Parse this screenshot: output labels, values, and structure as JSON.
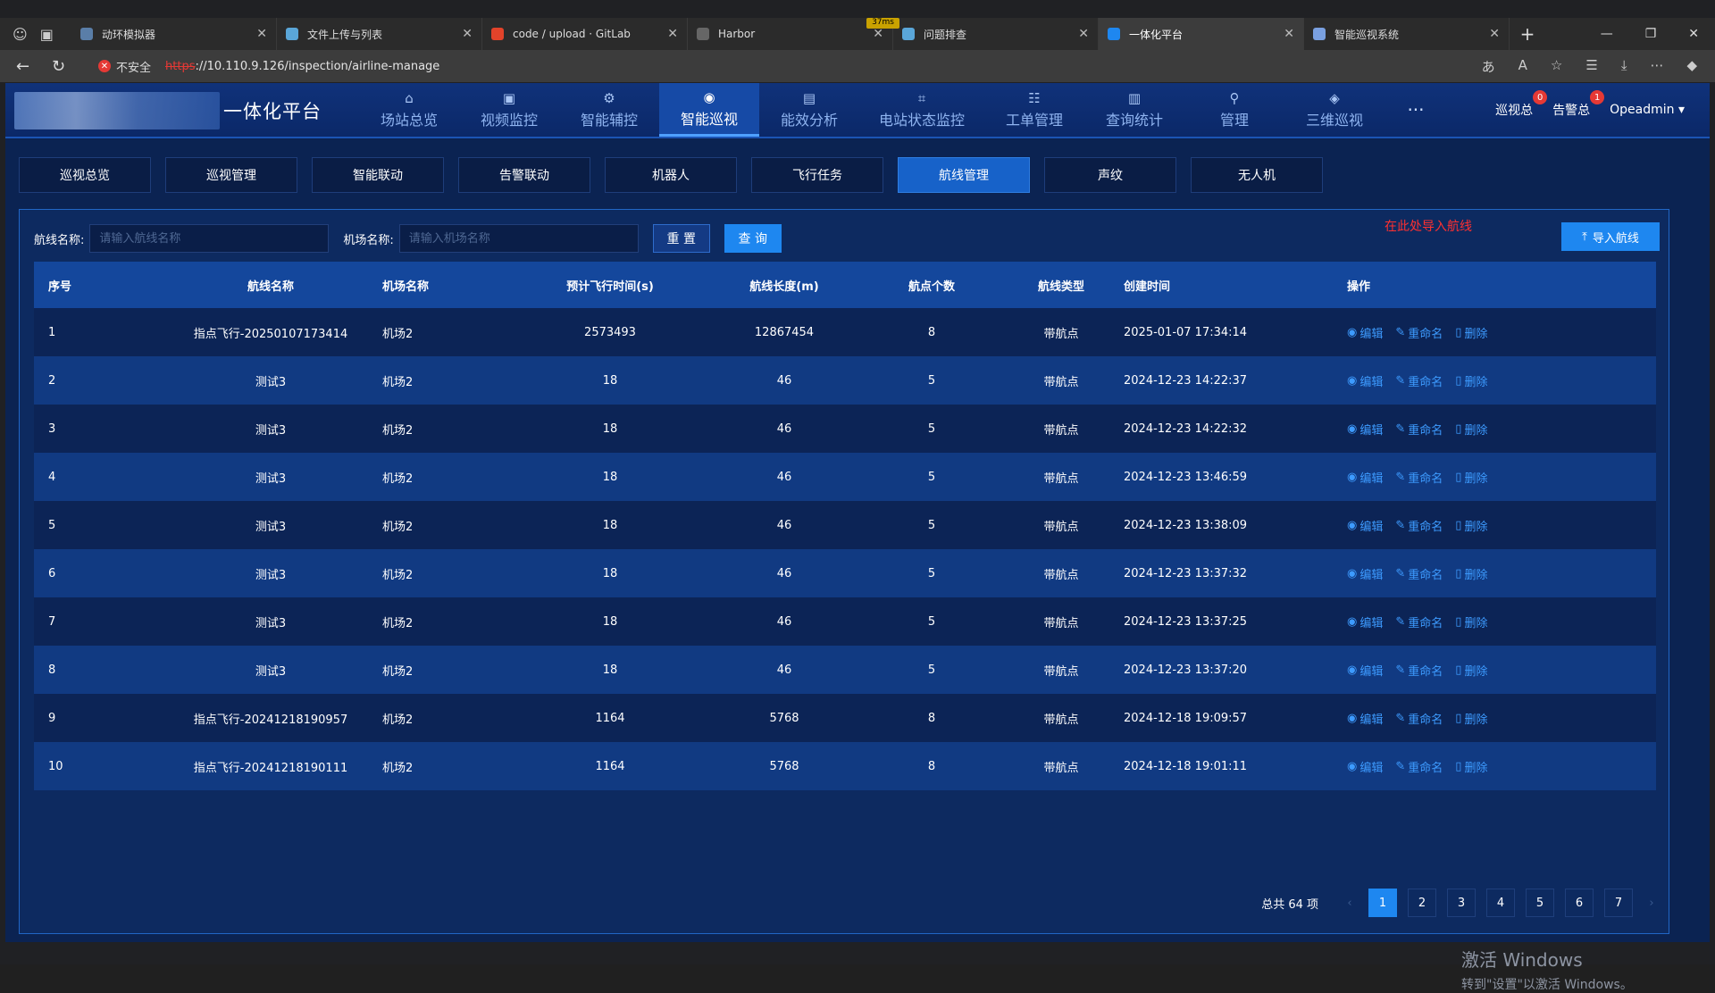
{
  "browser": {
    "tabs": [
      {
        "title": "动环模拟器",
        "color": "#5a7ea8"
      },
      {
        "title": "文件上传与列表",
        "color": "#5aa6d8"
      },
      {
        "title": "code / upload · GitLab",
        "color": "#e2432a"
      },
      {
        "title": "Harbor",
        "color": "#666666"
      },
      {
        "title": "问题排查",
        "color": "#5aa6d8"
      },
      {
        "title": "一体化平台",
        "color": "#1e87f0"
      },
      {
        "title": "智能巡视系统",
        "color": "#7aa0e0"
      }
    ],
    "active_tab_index": 5,
    "network_badge": "37ms",
    "security_label": "不安全",
    "url_https": "https",
    "url_rest": "://10.110.9.126/inspection/airline-manage"
  },
  "header": {
    "brand_name": "一体化平台",
    "nav": [
      {
        "label": "场站总览",
        "icon": "home-icon"
      },
      {
        "label": "视频监控",
        "icon": "video-icon"
      },
      {
        "label": "智能辅控",
        "icon": "control-icon"
      },
      {
        "label": "智能巡视",
        "icon": "inspect-icon"
      },
      {
        "label": "能效分析",
        "icon": "analysis-icon"
      },
      {
        "label": "电站状态监控",
        "icon": "monitor-icon"
      },
      {
        "label": "工单管理",
        "icon": "order-icon"
      },
      {
        "label": "查询统计",
        "icon": "stats-icon"
      },
      {
        "label": "管理",
        "icon": "location-icon"
      },
      {
        "label": "三维巡视",
        "icon": "3d-icon"
      }
    ],
    "active_nav_index": 3,
    "more": "···",
    "inspect_total_label": "巡视总",
    "inspect_total_count": "0",
    "alarm_total_label": "告警总",
    "alarm_total_count": "1",
    "user": "Opeadmin"
  },
  "subtabs": [
    "巡视总览",
    "巡视管理",
    "智能联动",
    "告警联动",
    "机器人",
    "飞行任务",
    "航线管理",
    "声纹",
    "无人机"
  ],
  "active_subtab_index": 6,
  "filters": {
    "route_label": "航线名称:",
    "route_placeholder": "请输入航线名称",
    "airport_label": "机场名称:",
    "airport_placeholder": "请输入机场名称",
    "reset": "重 置",
    "query": "查 询",
    "import_hint": "在此处导入航线",
    "import": "导入航线"
  },
  "table": {
    "columns": [
      "序号",
      "航线名称",
      "机场名称",
      "预计飞行时间(s)",
      "航线长度(m)",
      "航点个数",
      "航线类型",
      "创建时间",
      "操作"
    ],
    "ops": [
      "编辑",
      "重命名",
      "删除"
    ],
    "rows": [
      [
        "1",
        "指点飞行-20250107173414",
        "机场2",
        "2573493",
        "12867454",
        "8",
        "带航点",
        "2025-01-07 17:34:14"
      ],
      [
        "2",
        "测试3",
        "机场2",
        "18",
        "46",
        "5",
        "带航点",
        "2024-12-23 14:22:37"
      ],
      [
        "3",
        "测试3",
        "机场2",
        "18",
        "46",
        "5",
        "带航点",
        "2024-12-23 14:22:32"
      ],
      [
        "4",
        "测试3",
        "机场2",
        "18",
        "46",
        "5",
        "带航点",
        "2024-12-23 13:46:59"
      ],
      [
        "5",
        "测试3",
        "机场2",
        "18",
        "46",
        "5",
        "带航点",
        "2024-12-23 13:38:09"
      ],
      [
        "6",
        "测试3",
        "机场2",
        "18",
        "46",
        "5",
        "带航点",
        "2024-12-23 13:37:32"
      ],
      [
        "7",
        "测试3",
        "机场2",
        "18",
        "46",
        "5",
        "带航点",
        "2024-12-23 13:37:25"
      ],
      [
        "8",
        "测试3",
        "机场2",
        "18",
        "46",
        "5",
        "带航点",
        "2024-12-23 13:37:20"
      ],
      [
        "9",
        "指点飞行-20241218190957",
        "机场2",
        "1164",
        "5768",
        "8",
        "带航点",
        "2024-12-18 19:09:57"
      ],
      [
        "10",
        "指点飞行-20241218190111",
        "机场2",
        "1164",
        "5768",
        "8",
        "带航点",
        "2024-12-18 19:01:11"
      ]
    ]
  },
  "pagination": {
    "total": "总共 64 项",
    "pages": [
      "1",
      "2",
      "3",
      "4",
      "5",
      "6",
      "7"
    ],
    "current": "1"
  },
  "watermark": {
    "line1": "激活 Windows",
    "line2": "转到\"设置\"以激活 Windows。"
  }
}
